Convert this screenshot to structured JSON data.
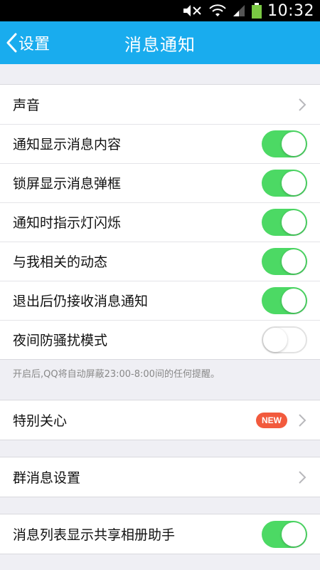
{
  "status_bar": {
    "time": "10:32",
    "icons": [
      "mute-icon",
      "wifi-icon",
      "signal-icon",
      "battery-icon"
    ]
  },
  "header": {
    "back_label": "设置",
    "title": "消息通知"
  },
  "groups": {
    "main": {
      "sound": "声音",
      "items": [
        {
          "label": "通知显示消息内容",
          "on": true
        },
        {
          "label": "锁屏显示消息弹框",
          "on": true
        },
        {
          "label": "通知时指示灯闪烁",
          "on": true
        },
        {
          "label": "与我相关的动态",
          "on": true
        },
        {
          "label": "退出后仍接收消息通知",
          "on": true
        },
        {
          "label": "夜间防骚扰模式",
          "on": false
        }
      ]
    },
    "hint": "开启后,QQ将自动屏蔽23:00-8:00间的任何提醒。",
    "special": {
      "label": "特别关心",
      "badge": "NEW"
    },
    "group_settings": {
      "label": "群消息设置"
    },
    "album": {
      "label": "消息列表显示共享相册助手",
      "on": true
    }
  },
  "colors": {
    "header": "#19acee",
    "toggle_on": "#4cd964",
    "badge": "#f25a3d",
    "background": "#efeff4"
  }
}
